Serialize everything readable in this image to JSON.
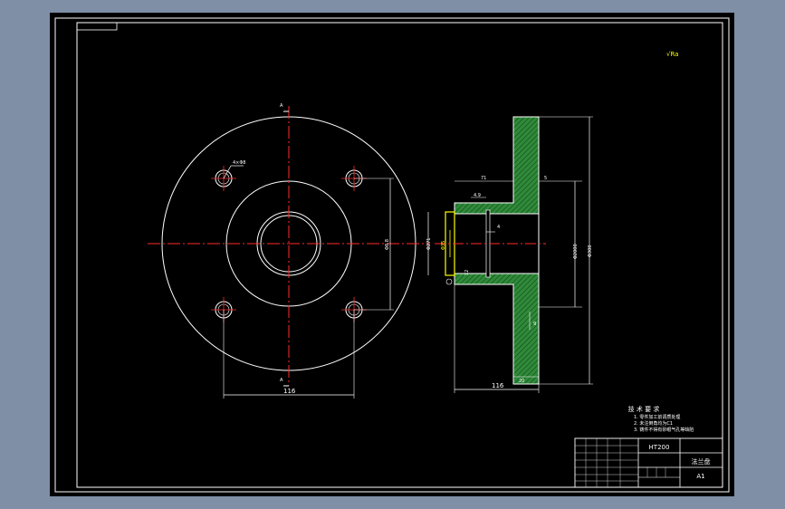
{
  "drawing": {
    "front_view": {
      "section_mark_top": "A",
      "section_mark_bottom": "A",
      "hole_note": "4×Φ8",
      "dim_bolt_circle": "Φ8.8",
      "dim_bottom": "116"
    },
    "section_view": {
      "dim_71": "71",
      "dim_49": "4.9",
      "dim_right_top": "5",
      "dim_4": "4",
      "dim_bore": "Φ271",
      "dim_bore_note": "Φ35",
      "dim_12": "12",
      "dim_inner_dia": "Φ2000",
      "dim_outer_dia": "Φ300",
      "dim_9": "9",
      "dim_20": "20",
      "dim_bottom": "116"
    },
    "roughness_note": "√Ra"
  },
  "technical_requirements": {
    "title": "技 术 要 求",
    "items": [
      "1. 零件加工前调质处理",
      "2. 未注倒角均为C1",
      "3. 铸件不得有砂眼气孔等缺陷"
    ]
  },
  "title_block": {
    "material": "HT200",
    "part_name": "法兰盘",
    "sheet_size": "A1"
  },
  "colors": {
    "background": "#000000",
    "outline": "#ffffff",
    "centerline": "#ff2a2a",
    "hatch": "#2f8a3a",
    "highlight": "#ffff00",
    "border_outer": "#7e8fa6"
  }
}
